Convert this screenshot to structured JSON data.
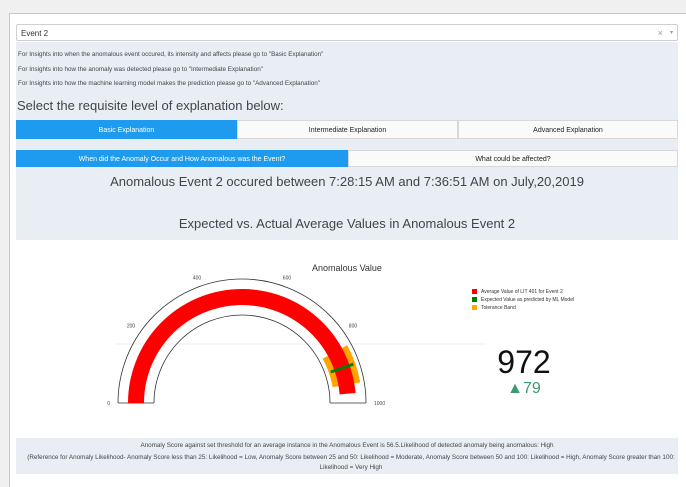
{
  "dropdown": {
    "value": "Event 2",
    "clear_icon": "×",
    "caret_icon": "▾"
  },
  "info_lines": [
    "For Insights into when the anomalous event occured, its intensity and affects please go to \"Basic Explanation\"",
    "For Insights into how the anomaly was detected please go to \"Intermediate Explanation\"",
    "For Insights into how the machine learning model makes the prediction please go to \"Advanced Explanation\""
  ],
  "heading": "Select the requisite level of explanation below:",
  "level_tabs": [
    {
      "label": "Basic Explanation",
      "active": true
    },
    {
      "label": "Intermediate Explanation",
      "active": false
    },
    {
      "label": "Advanced Explanation",
      "active": false
    }
  ],
  "sub_tabs": [
    {
      "label": "When did the Anomaly Occur and How Anomalous was the Event?",
      "active": true
    },
    {
      "label": "What could be affected?",
      "active": false
    }
  ],
  "event_title": "Anomalous Event 2 occured between 7:28:15 AM and 7:36:51 AM on July,20,2019",
  "chart_section_title": "Expected vs. Actual Average Values in Anomalous Event 2",
  "chart_data": {
    "type": "gauge",
    "title": "Anomalous Value",
    "range": [
      0,
      1000
    ],
    "tick_labels": [
      "0",
      "200",
      "400",
      "600",
      "800",
      "1000"
    ],
    "value": 972,
    "delta": "▲79",
    "expected_value": 893,
    "tolerance_band": [
      840,
      945
    ],
    "series": [
      {
        "name": "Average Value of LIT 401 for Event 2",
        "color": "#ff0000"
      },
      {
        "name": "Expected Value as predicted by ML Model",
        "color": "#008000"
      },
      {
        "name": "Tolerance Band",
        "color": "#ffa500"
      }
    ]
  },
  "footer": {
    "line1": "Anomaly Score against set threshold for an average instance in the Anomalous Event is 56.5.Likelihood of detected anomaly being anomalous: High",
    "line2": "(Reference for Anomaly Likelihood- Anomaly Score less than 25: Likelihood = Low, Anomaly Score between 25 and 50: Likelihood = Moderate, Anomaly Score between 50 and 100: Likelihood = High, Anomaly Score greater than 100: Likelihood = Very High"
  }
}
